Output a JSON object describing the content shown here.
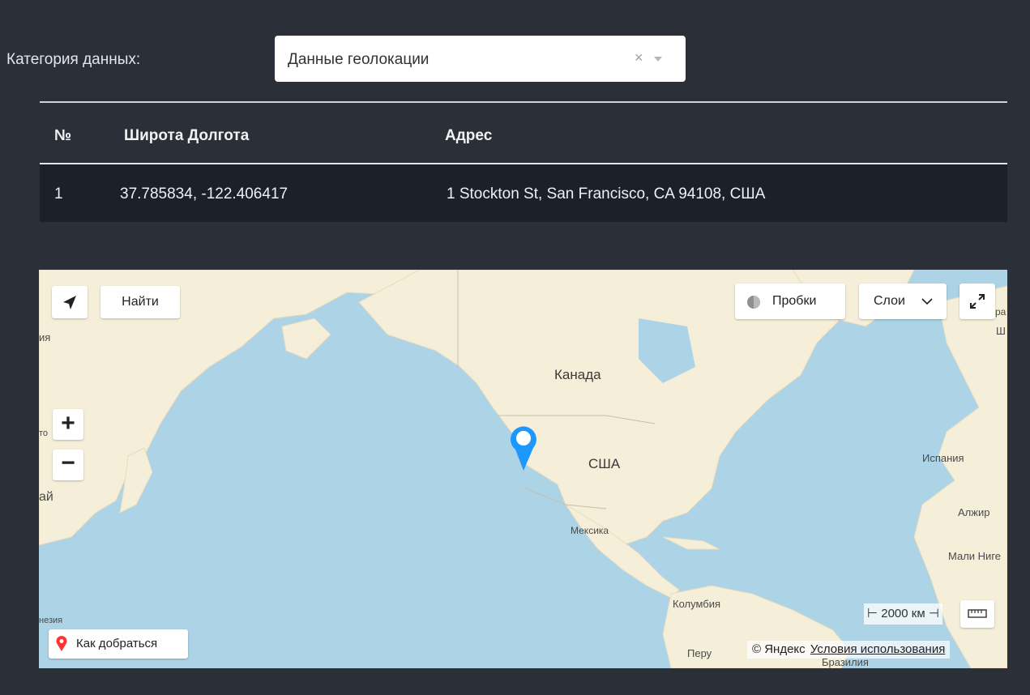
{
  "filter": {
    "label": "Категория данных:",
    "selected": "Данные геолокации",
    "clear_symbol": "×"
  },
  "table": {
    "headers": [
      "№",
      "Широта Долгота",
      "Адрес"
    ],
    "rows": [
      [
        "1",
        "37.785834, -122.406417",
        "1 Stockton St, San Francisco, CA 94108, США"
      ]
    ]
  },
  "map": {
    "controls": {
      "find_label": "Найти",
      "traffic_label": "Пробки",
      "layers_label": "Слои",
      "zoom_in": "+",
      "zoom_out": "−",
      "route_label": "Как добраться",
      "scale_label": "2000 км"
    },
    "attribution": {
      "copyright": "© Яндекс",
      "terms_link": "Условия использования"
    },
    "labels": {
      "canada": "Канада",
      "usa": "США",
      "mexico": "Мексика",
      "colombia": "Колумбия",
      "peru": "Перу",
      "brazil": "Бразилия",
      "spain": "Испания",
      "algeria": "Алжир",
      "mali": "Мали Ниге",
      "edge_ia": "ия",
      "edge_ai": "ай",
      "edge_to": "то",
      "edge_nezia": "незия",
      "edge_ra": "ра",
      "edge_sh": "Ш"
    },
    "colors": {
      "water": "#acd3e6",
      "land": "#f5efd9",
      "marker": "#1e98ff",
      "route_pin": "#ff3333"
    }
  }
}
